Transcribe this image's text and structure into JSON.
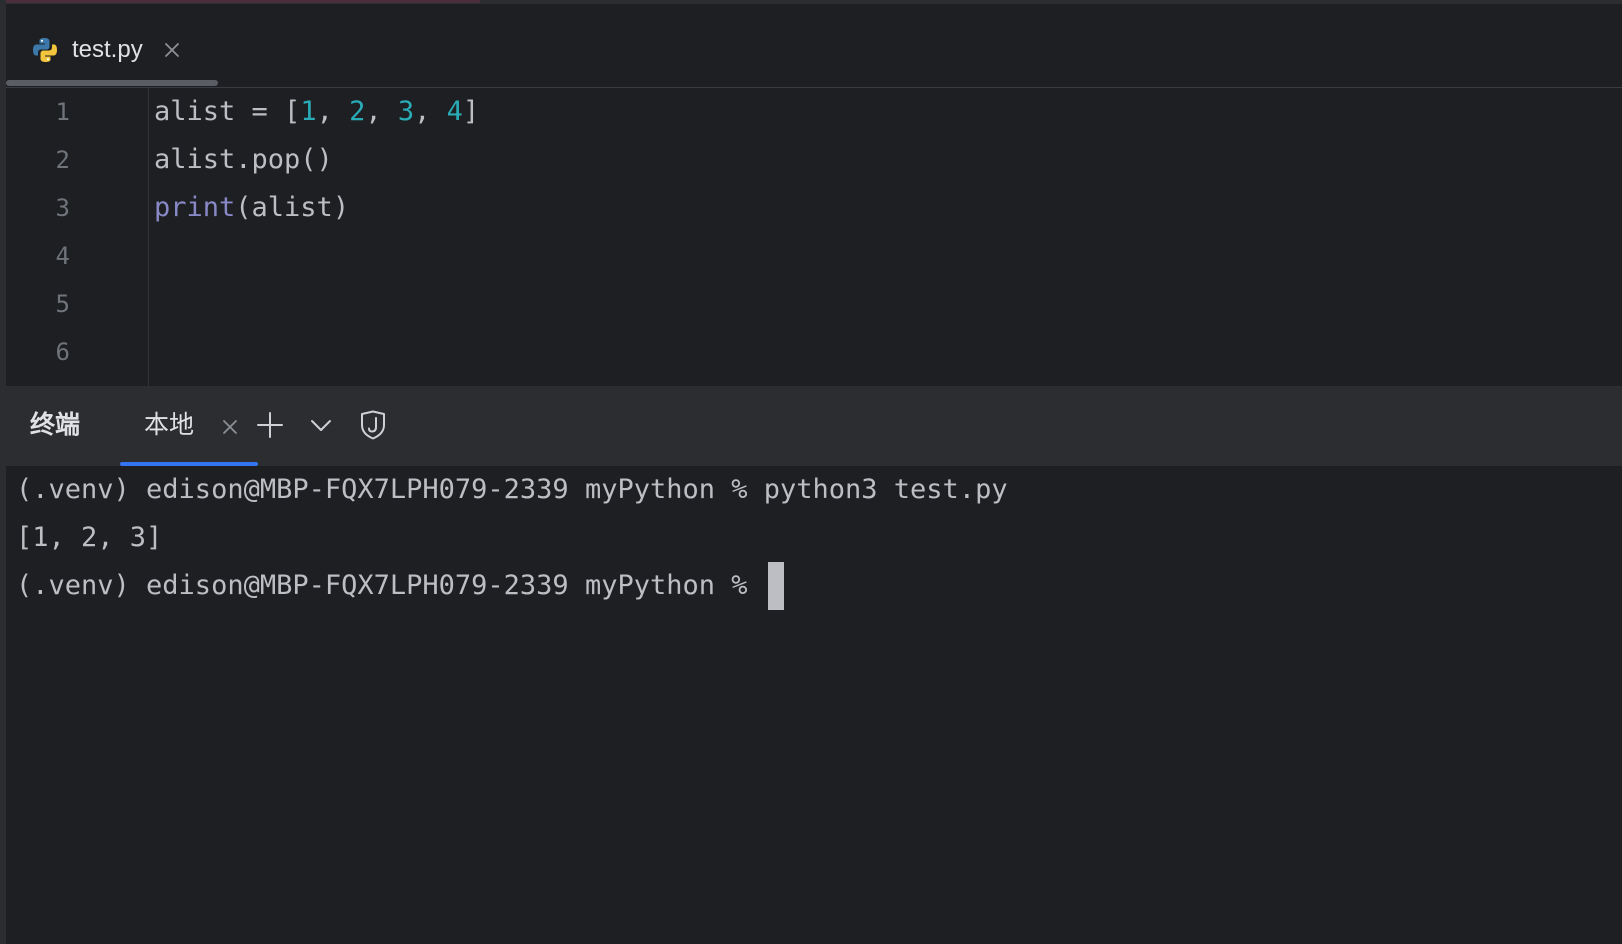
{
  "editor": {
    "tab": {
      "filename": "test.py",
      "icon": "python-icon"
    },
    "line_numbers": [
      "1",
      "2",
      "3",
      "4",
      "5",
      "6"
    ],
    "code": {
      "line1": {
        "text_a": "alist = [",
        "n1": "1",
        "sep1": ", ",
        "n2": "2",
        "sep2": ", ",
        "n3": "3",
        "sep3": ", ",
        "n4": "4",
        "text_b": "]"
      },
      "line2": "alist.pop()",
      "line3": {
        "func": "print",
        "args": "(alist)"
      }
    },
    "colors": {
      "number": "#2aacb8",
      "builtin": "#8888c6",
      "text": "#bcbec4"
    }
  },
  "terminal": {
    "title": "终端",
    "tab_label": "本地",
    "icons": [
      "close-icon",
      "plus-icon",
      "chevron-down-icon",
      "shield-j-icon"
    ],
    "lines": [
      "(.venv) edison@MBP-FQX7LPH079-2339 myPython % python3 test.py",
      "[1, 2, 3]",
      "(.venv) edison@MBP-FQX7LPH079-2339 myPython % "
    ],
    "accent_color": "#3574f0"
  }
}
